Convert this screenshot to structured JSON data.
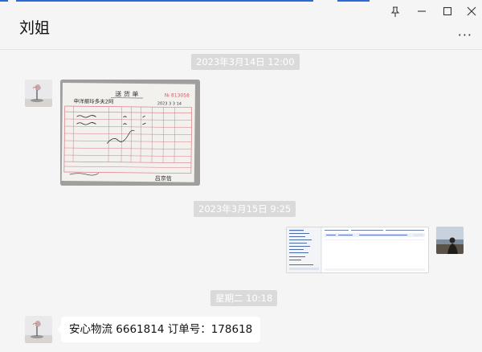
{
  "window": {
    "title": "刘姐",
    "pin_icon": "pin-icon",
    "minimize_icon": "minimize-icon",
    "maximize_icon": "maximize-icon",
    "close_icon": "close-icon",
    "more_icon": "more-icon",
    "more_glyph": "···"
  },
  "messages": [
    {
      "type": "timestamp",
      "text": "2023年3月14日 12:00"
    },
    {
      "type": "image",
      "sender": "刘姐",
      "description_icon": "delivery-note-photo"
    },
    {
      "type": "timestamp",
      "text": "2023年3月15日 9:25"
    },
    {
      "type": "image",
      "sender": "me",
      "description_icon": "screenshot-thumbnail"
    },
    {
      "type": "timestamp",
      "text": "星期二 10:18"
    },
    {
      "type": "text",
      "sender": "刘姐",
      "text": "安心物流 6661814  订单号：178618"
    }
  ],
  "delivery_note": {
    "header": "送 货 单",
    "number": "№ 813058",
    "customer_handwritten": "申洋振玲多夫2阿",
    "date_handwritten": "2023 3 3 14",
    "signature_handwritten": "吕京信"
  },
  "colors": {
    "background": "#f5f5f5",
    "timestamp_bg": "#dadada",
    "accent": "#2b6ad6",
    "bubble_bg": "#ffffff"
  }
}
